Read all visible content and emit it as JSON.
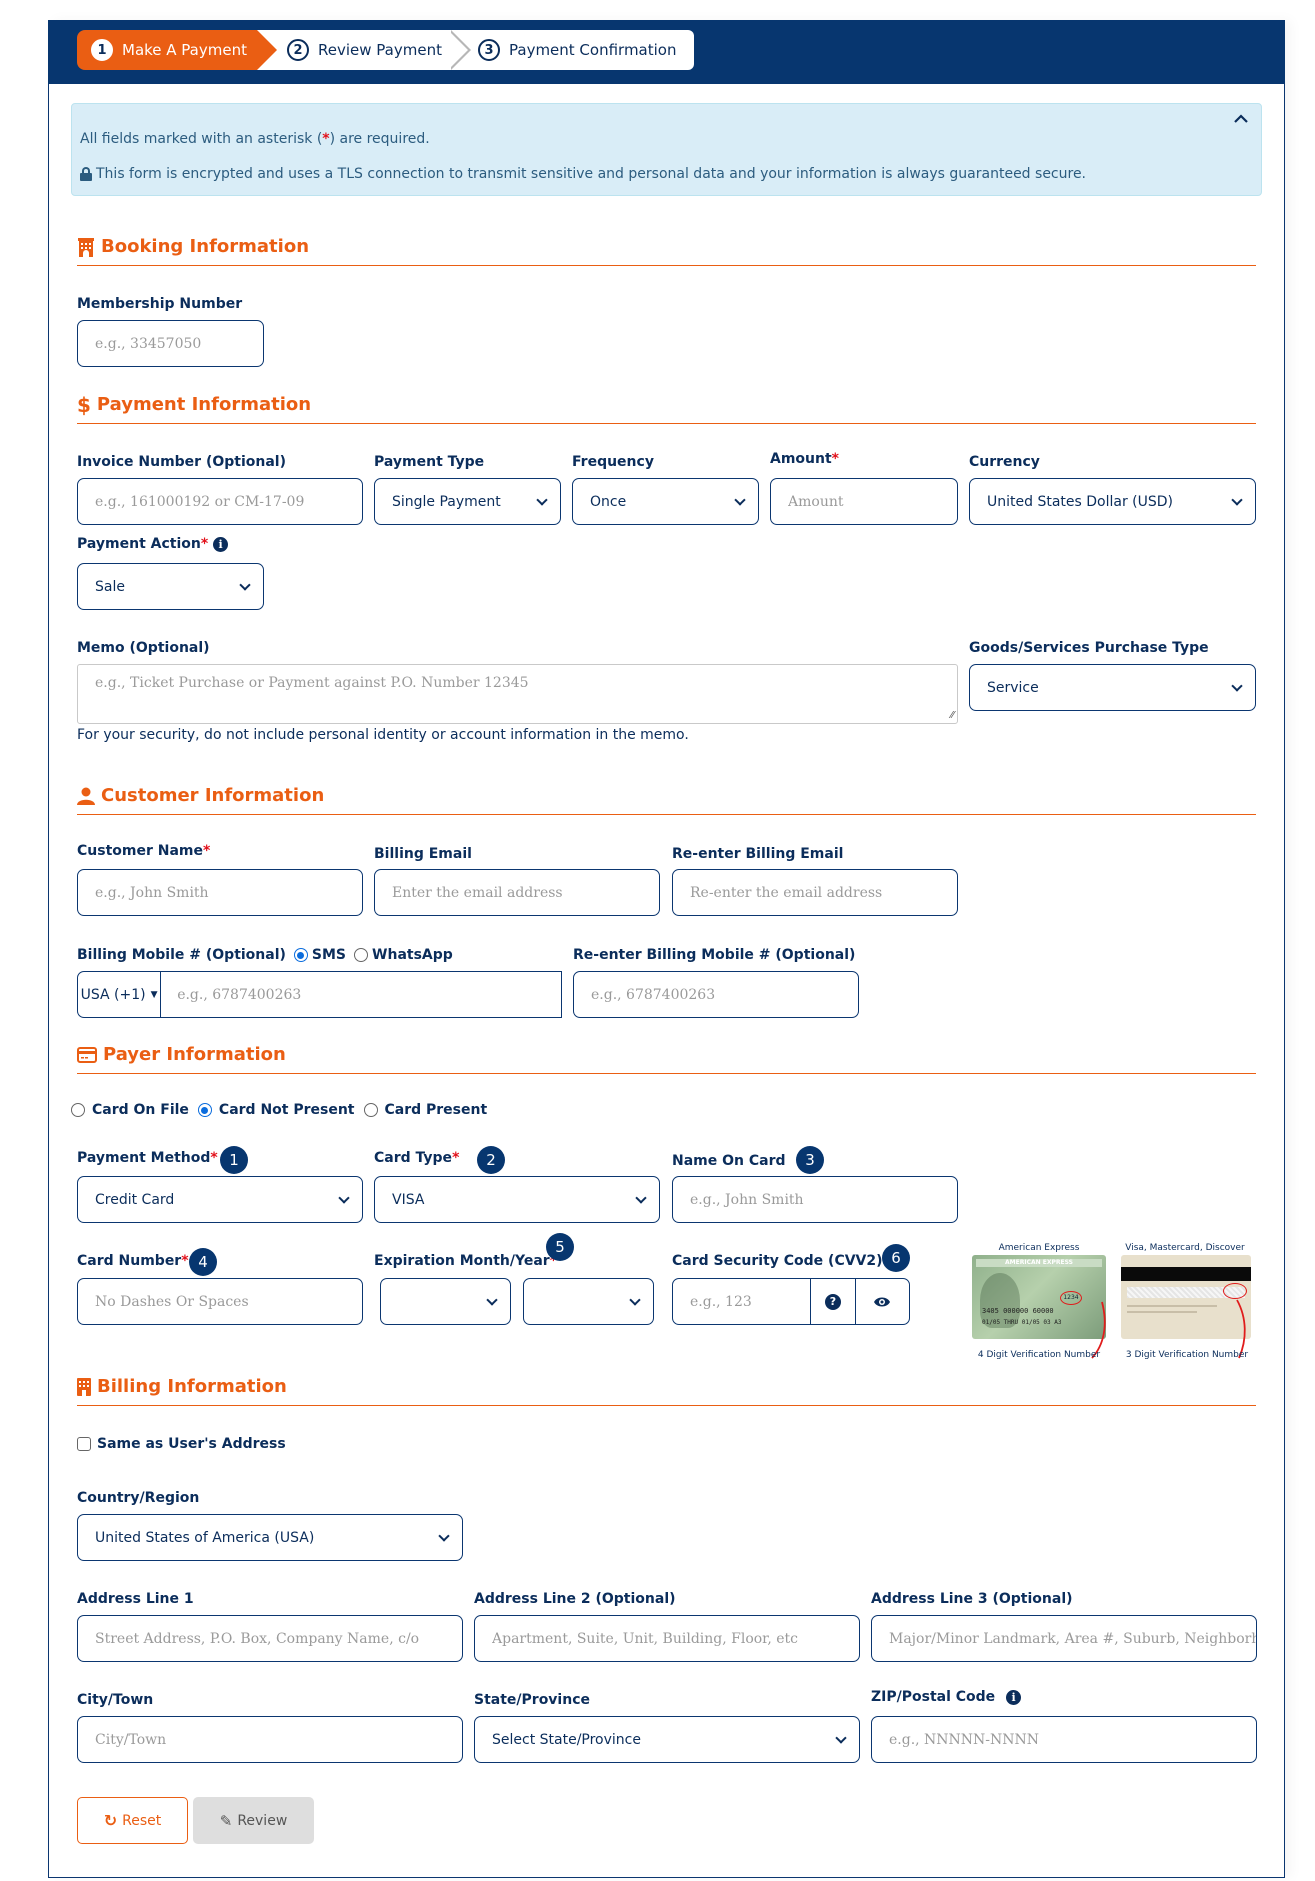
{
  "stepper": [
    {
      "num": "1",
      "label": "Make A Payment",
      "active": true
    },
    {
      "num": "2",
      "label": "Review Payment",
      "active": false
    },
    {
      "num": "3",
      "label": "Payment Confirmation",
      "active": false
    }
  ],
  "notice": {
    "required_prefix": "All fields marked with an asterisk (",
    "required_star": "*",
    "required_suffix": ") are required.",
    "security": "This form is encrypted and uses a TLS connection to transmit sensitive and personal data and your information is always guaranteed secure.",
    "collapse_icon": "chevron-up-icon"
  },
  "booking": {
    "heading": "Booking Information",
    "icon": "hotel-icon",
    "membership_label": "Membership Number",
    "membership_placeholder": "e.g., 33457050"
  },
  "payment": {
    "heading": "Payment Information",
    "icon": "dollar-icon",
    "invoice_label": "Invoice Number (Optional)",
    "invoice_placeholder": "e.g., 161000192 or CM-17-09",
    "type_label": "Payment Type",
    "type_value": "Single Payment",
    "frequency_label": "Frequency",
    "frequency_value": "Once",
    "amount_label": "Amount",
    "amount_placeholder": "Amount",
    "currency_label": "Currency",
    "currency_value": "United States Dollar (USD)",
    "action_label": "Payment Action",
    "action_value": "Sale",
    "memo_label": "Memo (Optional)",
    "memo_placeholder": "e.g., Ticket Purchase or Payment against P.O. Number 12345",
    "memo_note": "For your security, do not include personal identity or account information in the memo.",
    "goods_label": "Goods/Services Purchase Type",
    "goods_value": "Service"
  },
  "customer": {
    "heading": "Customer Information",
    "icon": "user-icon",
    "name_label": "Customer Name",
    "name_placeholder": "e.g., John Smith",
    "email_label": "Billing Email",
    "email_placeholder": "Enter the email address",
    "reemail_label": "Re-enter Billing Email",
    "reemail_placeholder": "Re-enter the email address",
    "mobile_label": "Billing Mobile # (Optional)",
    "sms_label": "SMS",
    "whatsapp_label": "WhatsApp",
    "country_code": "USA (+1)",
    "mobile_placeholder": "e.g., 6787400263",
    "remobile_label": "Re-enter Billing Mobile # (Optional)",
    "remobile_placeholder": "e.g., 6787400263"
  },
  "payer": {
    "heading": "Payer Information",
    "icon": "credit-card-icon",
    "modes": [
      "Card On File",
      "Card Not Present",
      "Card Present"
    ],
    "selected_mode": "Card Not Present",
    "method_label": "Payment Method",
    "method_value": "Credit Card",
    "card_type_label": "Card Type",
    "card_type_value": "VISA",
    "name_on_card_label": "Name On Card",
    "name_on_card_placeholder": "e.g., John Smith",
    "card_number_label": "Card Number",
    "card_number_placeholder": "No Dashes Or Spaces",
    "expiration_label": "Expiration Month/Year",
    "cvv_label": "Card Security Code (CVV2)",
    "cvv_placeholder": "e.g., 123",
    "badges": [
      "1",
      "2",
      "3",
      "4",
      "5",
      "6"
    ],
    "amex_title": "American Express",
    "amex_caption": "4 Digit Verification Number",
    "visa_title": "Visa, Mastercard, Discover",
    "visa_caption": "3 Digit Verification Number",
    "amex_code": "1234"
  },
  "billing": {
    "heading": "Billing Information",
    "icon": "building-icon",
    "same_address_label": "Same as User's Address",
    "country_label": "Country/Region",
    "country_value": "United States of America (USA)",
    "addr1_label": "Address Line 1",
    "addr1_placeholder": "Street Address, P.O. Box, Company Name, c/o",
    "addr2_label": "Address Line 2 (Optional)",
    "addr2_placeholder": "Apartment, Suite, Unit, Building, Floor, etc",
    "addr3_label": "Address Line 3 (Optional)",
    "addr3_placeholder": "Major/Minor Landmark, Area #, Suburb, Neighborhood",
    "city_label": "City/Town",
    "city_placeholder": "City/Town",
    "state_label": "State/Province",
    "state_value": "Select State/Province",
    "zip_label": "ZIP/Postal Code",
    "zip_placeholder": "e.g., NNNNN-NNNN"
  },
  "actions": {
    "reset_label": "Reset",
    "review_label": "Review"
  },
  "colors": {
    "primary": "#07366f",
    "accent": "#ea5e13",
    "required": "#e2101a",
    "info_bg": "#d9edf7"
  }
}
